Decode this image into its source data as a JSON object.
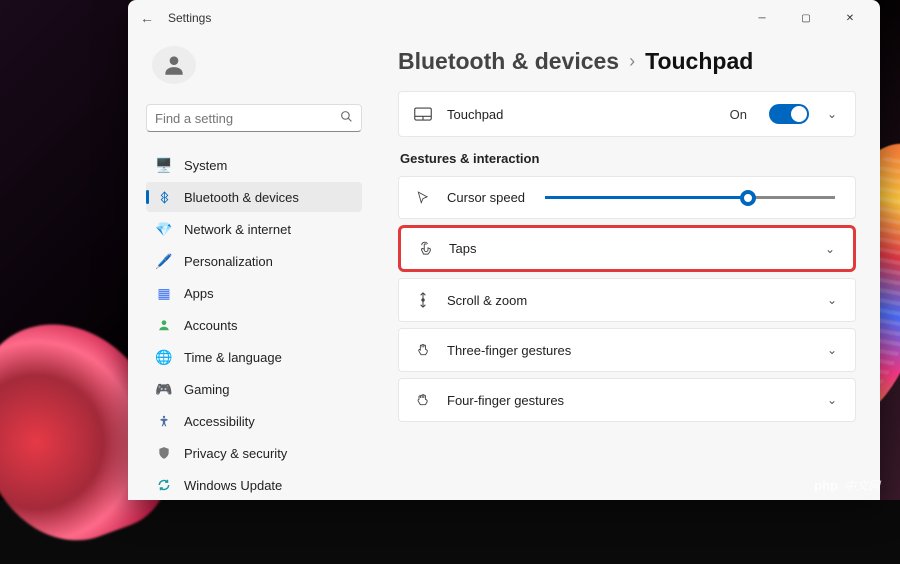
{
  "window": {
    "title": "Settings"
  },
  "sidebar": {
    "search_placeholder": "Find a setting",
    "items": [
      {
        "icon": "monitor",
        "label": "System",
        "color": "#3a6ff0"
      },
      {
        "icon": "bluetooth",
        "label": "Bluetooth & devices",
        "color": "#0067c0",
        "active": true
      },
      {
        "icon": "wifi",
        "label": "Network & internet",
        "color": "#00b0d8"
      },
      {
        "icon": "brush",
        "label": "Personalization",
        "color": "#d08a2a"
      },
      {
        "icon": "apps",
        "label": "Apps",
        "color": "#3a6ff0"
      },
      {
        "icon": "account",
        "label": "Accounts",
        "color": "#3fae5f"
      },
      {
        "icon": "clock",
        "label": "Time & language",
        "color": "#2a9ed8"
      },
      {
        "icon": "gamepad",
        "label": "Gaming",
        "color": "#7a7a7a"
      },
      {
        "icon": "accessibility",
        "label": "Accessibility",
        "color": "#4a6fa0"
      },
      {
        "icon": "shield",
        "label": "Privacy & security",
        "color": "#7a7a7a"
      },
      {
        "icon": "update",
        "label": "Windows Update",
        "color": "#1a9a9a"
      }
    ]
  },
  "breadcrumb": {
    "parent": "Bluetooth & devices",
    "separator": "›",
    "current": "Touchpad"
  },
  "cards": {
    "touchpad": {
      "label": "Touchpad",
      "state": "On"
    }
  },
  "section_header": "Gestures & interaction",
  "rows": {
    "cursor_speed": {
      "label": "Cursor speed",
      "slider_value": 70
    },
    "taps": {
      "label": "Taps"
    },
    "scroll_zoom": {
      "label": "Scroll & zoom"
    },
    "three_finger": {
      "label": "Three-finger gestures"
    },
    "four_finger": {
      "label": "Four-finger gestures"
    }
  },
  "watermark": {
    "logo": "php",
    "text": "中文网"
  },
  "chart_data": {
    "type": "table",
    "note": "single slider value",
    "value": 70,
    "range": [
      0,
      100
    ]
  }
}
